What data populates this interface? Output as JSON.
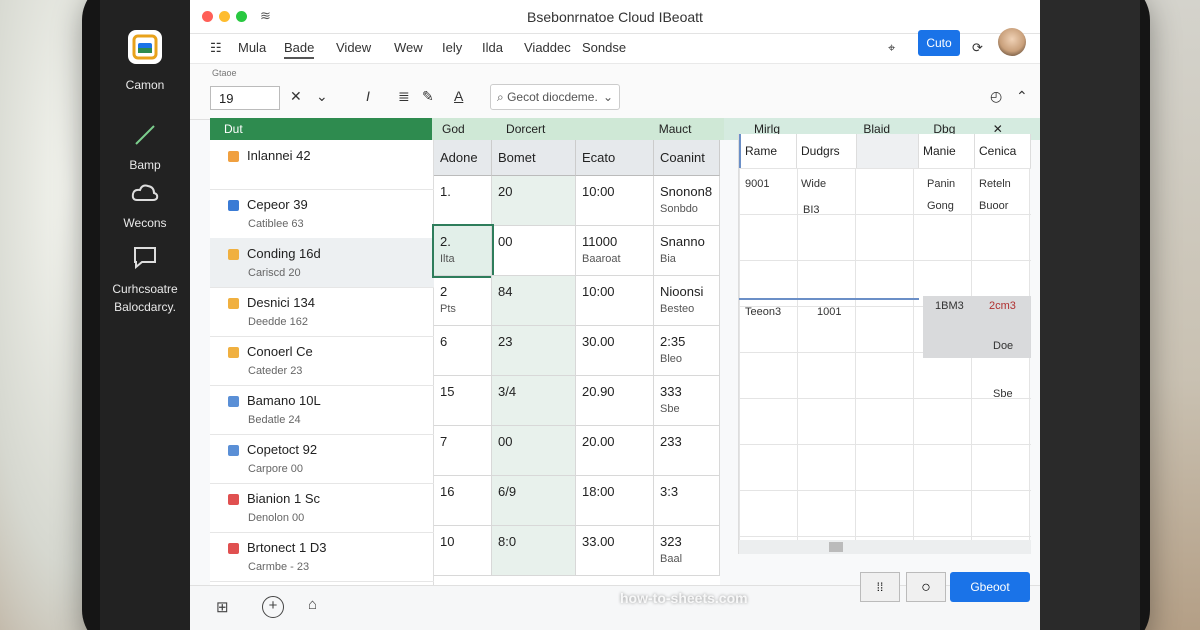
{
  "window": {
    "title": "Bsebonrnatoe Cloud IBeoatt"
  },
  "dock": {
    "app_label": "Camon",
    "items": [
      {
        "label": "Bamp"
      },
      {
        "label": "Wecons"
      },
      {
        "label": "Curhcsoatre Balocdarcy."
      }
    ]
  },
  "menu": [
    "Mula",
    "Bade",
    "Videw",
    "Wew",
    "Iely",
    "Ilda",
    "Viaddec",
    "Sondse"
  ],
  "header": {
    "share_label": "Cuto"
  },
  "toolbar": {
    "tiny_label": "Gtaoe",
    "cell_ref": "19",
    "search_placeholder": "Gecot diocdeme."
  },
  "columns": {
    "green_label": "Dut",
    "secondary": [
      "God",
      "Dorcert",
      "Mauct",
      "Mirlg",
      "Blaid",
      "Dbg"
    ]
  },
  "sidebar": [
    {
      "title": "Inlannei 42",
      "sub": "",
      "color": "#f0a040"
    },
    {
      "title": "Cepeor 39",
      "sub": "Catiblee 63",
      "color": "#3a7bd5"
    },
    {
      "title": "Conding 16d",
      "sub": "Cariscd 20",
      "color": "#f0b040"
    },
    {
      "title": "Desnici 134",
      "sub": "Deedde 162",
      "color": "#f0b040"
    },
    {
      "title": "Conoerl Ce",
      "sub": "Cateder 23",
      "color": "#f0b040"
    },
    {
      "title": "Bamano 10L",
      "sub": "Bedatle 24",
      "color": "#5a8fd6"
    },
    {
      "title": "Copetoct 92",
      "sub": "Carpore 00",
      "color": "#5a8fd6"
    },
    {
      "title": "Bianion 1 Sc",
      "sub": "Denolon 00",
      "color": "#e05050"
    },
    {
      "title": "Brtonect 1 D3",
      "sub": "Carmbe - 23",
      "color": "#e05050"
    }
  ],
  "table": {
    "headers": [
      "Adone",
      "Bomet",
      "Ecato",
      "Coanint"
    ],
    "rows": [
      [
        "1.",
        "20",
        "10:00",
        "Snonon8",
        "Sonbdo"
      ],
      [
        "2.",
        "00",
        "11000",
        "Snanno",
        "Bia"
      ],
      [
        "2",
        "84",
        "10:00",
        "Nioonsi",
        "Besteo"
      ],
      [
        "6",
        "23",
        "30.00",
        "2:35",
        "Bleo"
      ],
      [
        "15",
        "3/4",
        "20.90",
        "333",
        "Sbe"
      ],
      [
        "7",
        "00",
        "20.00",
        "233",
        ""
      ],
      [
        "16",
        "6/9",
        "18:00",
        "3:3",
        ""
      ],
      [
        "10",
        "8:0",
        "33.00",
        "323",
        "Baal"
      ]
    ],
    "row_subs": [
      "",
      "Ilta",
      "Pts",
      "",
      "",
      "",
      "",
      ""
    ],
    "sub2": [
      "",
      "Baaroat",
      "",
      "",
      "",
      "",
      "",
      ""
    ]
  },
  "grid2": {
    "headers": [
      "Rame",
      "Dudgrs",
      "",
      "",
      "Manie",
      "Cenica"
    ],
    "cells": [
      {
        "text": "9001"
      },
      {
        "text": "Wide"
      },
      {
        "text": "BI3"
      },
      {
        "text": "Panin"
      },
      {
        "text": "Reteln"
      },
      {
        "text": "Gong"
      },
      {
        "text": "Buoor"
      },
      {
        "text": "Teeon3"
      },
      {
        "text": "1001"
      },
      {
        "text": "1BM3"
      },
      {
        "text": "2cm3"
      },
      {
        "text": "Doe"
      },
      {
        "text": "Sbe"
      }
    ]
  },
  "bottom": {
    "primary_button": "Gbeoot",
    "left_icons": [
      "grid-icon",
      "plus-icon",
      "home-icon"
    ],
    "watermark": "how-to-sheets.com"
  },
  "colors": {
    "accent": "#1a73e8",
    "green": "#2e8b4f",
    "green_light": "#cfe8d6"
  }
}
